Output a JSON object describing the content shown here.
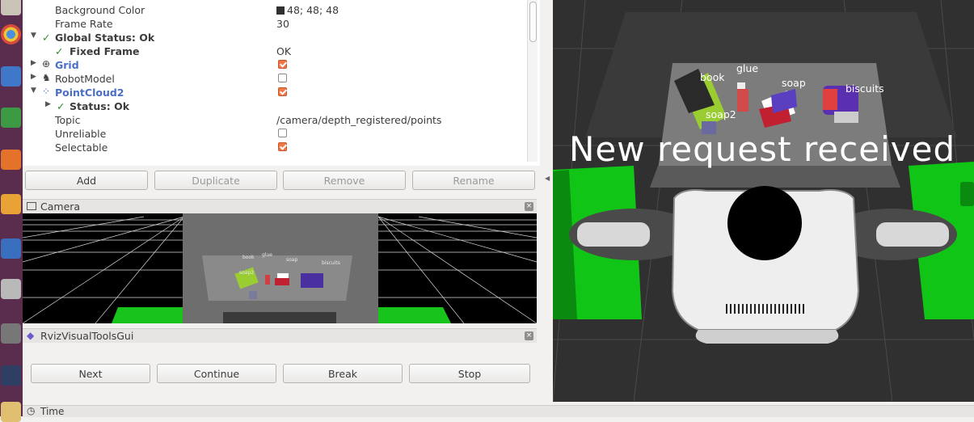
{
  "displays": {
    "rows": [
      {
        "name": "Background Color",
        "value": "48; 48; 48"
      },
      {
        "name": "Frame Rate",
        "value": "30"
      },
      {
        "name": "Global Status: Ok",
        "value": ""
      },
      {
        "name": "Fixed Frame",
        "value": "OK"
      },
      {
        "name": "Grid",
        "value": ""
      },
      {
        "name": "RobotModel",
        "value": ""
      },
      {
        "name": "PointCloud2",
        "value": ""
      },
      {
        "name": "Status: Ok",
        "value": ""
      },
      {
        "name": "Topic",
        "value": "/camera/depth_registered/points"
      },
      {
        "name": "Unreliable",
        "value": ""
      },
      {
        "name": "Selectable",
        "value": ""
      }
    ],
    "checkboxes": {
      "grid": true,
      "robotmodel": false,
      "pointcloud2": true,
      "unreliable": false,
      "selectable": true
    },
    "check_glyph": "✓",
    "colors": {
      "background_swatch": "#303030",
      "enabled_checkbox": "#f07746",
      "status_ok": "#2e8b2e",
      "display_blue": "#4a6fc4"
    }
  },
  "toolbar": {
    "add": "Add",
    "duplicate": "Duplicate",
    "remove": "Remove",
    "rename": "Rename"
  },
  "camera_panel": {
    "title": "Camera",
    "labels": {
      "book": "book",
      "glue": "glue",
      "soap": "soap",
      "biscuits": "biscuits",
      "soap2": "soap2"
    }
  },
  "rviz_gui": {
    "title": "RvizVisualToolsGui",
    "buttons": {
      "next": "Next",
      "continue": "Continue",
      "break": "Break",
      "stop": "Stop"
    }
  },
  "view3d": {
    "overlay": "New  request  received",
    "labels": {
      "book": "book",
      "glue": "glue",
      "soap": "soap",
      "biscuits": "biscuits",
      "soap2": "soap2"
    },
    "background_color": "#303030"
  },
  "time_panel": {
    "title": "Time"
  }
}
